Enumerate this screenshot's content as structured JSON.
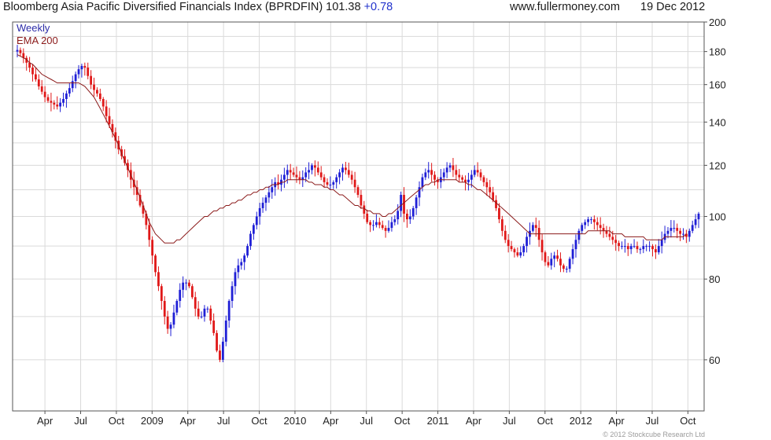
{
  "header": {
    "title": "Bloomberg Asia Pacific Diversified Financials Index (BPRDFIN) 101.38",
    "change": "+0.78",
    "site": "www.fullermoney.com",
    "date": "19 Dec 2012"
  },
  "copyright": "© 2012 Stockcube Research Ltd",
  "colors": {
    "up": "#1f1fd6",
    "down": "#e01818",
    "ema": "#8b1a1a",
    "weekly": "#2c2ca8",
    "grid": "#dadada"
  },
  "chart_data": {
    "type": "candlestick",
    "title": "Bloomberg Asia Pacific Diversified Financials Index (BPRDFIN)",
    "series": [
      {
        "name": "Weekly",
        "values": [
          181,
          179,
          176,
          173,
          170,
          166,
          163,
          159,
          156,
          153,
          151,
          150,
          149,
          148,
          150,
          152,
          155,
          158,
          162,
          166,
          169,
          171,
          170,
          165,
          160,
          157,
          155,
          152,
          148,
          143,
          139,
          135,
          131,
          127,
          124,
          121,
          118,
          114,
          111,
          108,
          104,
          101,
          97,
          92,
          87,
          82,
          78,
          74,
          70,
          67,
          68,
          71,
          74,
          77,
          79,
          79,
          78,
          75,
          72,
          70,
          70,
          72,
          72,
          69,
          66,
          62,
          60,
          64,
          69,
          74,
          78,
          82,
          84,
          85,
          87,
          90,
          94,
          97,
          100,
          103,
          105,
          107,
          109,
          111,
          113,
          112,
          114,
          116,
          118,
          117,
          116,
          115,
          114,
          115,
          117,
          118,
          120,
          119,
          117,
          115,
          113,
          112,
          112,
          113,
          115,
          117,
          119,
          118,
          116,
          114,
          111,
          108,
          104,
          101,
          98,
          97,
          97,
          98,
          97,
          96,
          95,
          96,
          98,
          99,
          102,
          108,
          101,
          99,
          100,
          103,
          107,
          111,
          115,
          117,
          118,
          116,
          114,
          113,
          115,
          117,
          119,
          120,
          118,
          116,
          115,
          114,
          113,
          114,
          116,
          118,
          117,
          115,
          113,
          111,
          109,
          106,
          103,
          99,
          95,
          92,
          90,
          89,
          88,
          87,
          88,
          90,
          93,
          95,
          97,
          96,
          92,
          88,
          85,
          84,
          86,
          87,
          86,
          84,
          83,
          83,
          86,
          89,
          92,
          95,
          97,
          98,
          99,
          99,
          98,
          97,
          96,
          95,
          94,
          93,
          92,
          91,
          90,
          90,
          90,
          89,
          90,
          90,
          89,
          89,
          90,
          90,
          90,
          89,
          88,
          90,
          92,
          94,
          95,
          96,
          96,
          95,
          94,
          94,
          93,
          95,
          97,
          99,
          101
        ]
      },
      {
        "name": "EMA 200",
        "values": [
          178,
          177,
          176,
          175,
          173,
          172,
          170,
          168,
          166,
          165,
          164,
          163,
          162,
          161,
          161,
          161,
          161,
          161,
          161,
          161,
          161,
          160,
          159,
          157,
          155,
          153,
          150,
          147,
          144,
          141,
          138,
          135,
          132,
          129,
          125,
          122,
          119,
          116,
          113,
          110,
          107,
          104,
          101,
          98,
          96,
          94,
          93,
          92,
          91,
          91,
          91,
          91,
          92,
          92,
          93,
          94,
          95,
          96,
          97,
          98,
          99,
          100,
          100,
          101,
          102,
          102,
          103,
          103,
          104,
          104,
          105,
          105,
          106,
          106,
          107,
          108,
          108,
          109,
          109,
          110,
          110,
          111,
          111,
          112,
          112,
          112,
          113,
          113,
          114,
          114,
          114,
          114,
          114,
          114,
          114,
          113,
          113,
          112,
          112,
          112,
          111,
          111,
          110,
          110,
          109,
          108,
          108,
          107,
          106,
          105,
          104,
          104,
          103,
          103,
          102,
          102,
          101,
          101,
          101,
          100,
          100,
          101,
          101,
          102,
          103,
          104,
          105,
          106,
          107,
          108,
          109,
          110,
          111,
          112,
          112,
          113,
          113,
          114,
          114,
          114,
          114,
          114,
          114,
          114,
          113,
          113,
          113,
          112,
          112,
          111,
          110,
          110,
          109,
          108,
          107,
          106,
          105,
          104,
          103,
          102,
          101,
          100,
          99,
          98,
          97,
          96,
          95,
          94,
          94,
          94,
          94,
          94,
          94,
          94,
          94,
          94,
          94,
          94,
          94,
          94,
          94,
          94,
          94,
          94,
          94,
          94,
          95,
          95,
          95,
          95,
          95,
          95,
          95,
          95,
          94,
          94,
          94,
          94,
          93,
          93,
          93,
          93,
          93,
          93,
          93,
          92,
          92,
          92,
          92,
          92,
          92,
          93,
          93,
          93,
          93,
          93,
          93,
          93,
          94
        ]
      }
    ],
    "x_tick_labels": [
      "Apr",
      "Jul",
      "Oct",
      "2009",
      "Apr",
      "Jul",
      "Oct",
      "2010",
      "Apr",
      "Jul",
      "Oct",
      "2011",
      "Apr",
      "Jul",
      "Oct",
      "2012",
      "Apr",
      "Jul",
      "Oct"
    ],
    "y_tick_labels": [
      "60",
      "80",
      "100",
      "120",
      "140",
      "160",
      "180",
      "200"
    ],
    "ylim": [
      50,
      200
    ],
    "y_scale": "log",
    "grid": true,
    "legend": "top-left"
  }
}
